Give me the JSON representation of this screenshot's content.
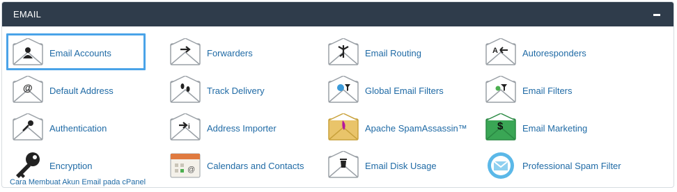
{
  "section": {
    "title": "EMAIL"
  },
  "items": [
    {
      "label": "Email Accounts",
      "icon": "user-envelope-icon"
    },
    {
      "label": "Forwarders",
      "icon": "arrow-envelope-icon"
    },
    {
      "label": "Email Routing",
      "icon": "routing-envelope-icon"
    },
    {
      "label": "Autoresponders",
      "icon": "autoresponder-envelope-icon"
    },
    {
      "label": "Default Address",
      "icon": "at-envelope-icon"
    },
    {
      "label": "Track Delivery",
      "icon": "footprints-envelope-icon"
    },
    {
      "label": "Global Email Filters",
      "icon": "globe-filter-envelope-icon"
    },
    {
      "label": "Email Filters",
      "icon": "filter-envelope-icon"
    },
    {
      "label": "Authentication",
      "icon": "key-envelope-icon"
    },
    {
      "label": "Address Importer",
      "icon": "importer-envelope-icon"
    },
    {
      "label": "Apache SpamAssassin™",
      "icon": "spamassassin-envelope-icon"
    },
    {
      "label": "Email Marketing",
      "icon": "dollar-envelope-icon"
    },
    {
      "label": "Encryption",
      "icon": "key-icon"
    },
    {
      "label": "Calendars and Contacts",
      "icon": "calendar-icon"
    },
    {
      "label": "Email Disk Usage",
      "icon": "trash-envelope-icon"
    },
    {
      "label": "Professional Spam Filter",
      "icon": "spam-filter-icon"
    }
  ],
  "caption": "Cara Membuat Akun Email pada cPanel",
  "colors": {
    "header_bg": "#2f3c4b",
    "link": "#1f6aa5",
    "highlight": "#4aa3e8"
  }
}
